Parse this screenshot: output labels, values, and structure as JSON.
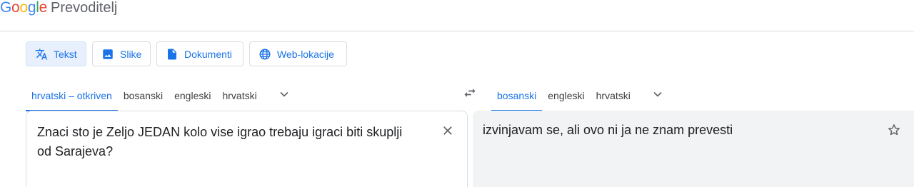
{
  "header": {
    "logo_letters": [
      "G",
      "o",
      "o",
      "g",
      "l",
      "e"
    ],
    "product": "Prevoditelj"
  },
  "modes": [
    {
      "label": "Tekst",
      "icon": "translate-icon",
      "active": true
    },
    {
      "label": "Slike",
      "icon": "image-icon",
      "active": false
    },
    {
      "label": "Dokumenti",
      "icon": "document-icon",
      "active": false
    },
    {
      "label": "Web-lokacije",
      "icon": "globe-icon",
      "active": false
    }
  ],
  "source_langs": [
    "hrvatski – otkriven",
    "bosanski",
    "engleski",
    "hrvatski"
  ],
  "target_langs": [
    "bosanski",
    "engleski",
    "hrvatski"
  ],
  "source": {
    "text": "Znaci sto je Zeljo JEDAN kolo vise igrao trebaju igraci biti skuplji od Sarajeva?"
  },
  "target": {
    "text": "izvinjavam se, ali ovo ni ja ne znam prevesti"
  },
  "colors": {
    "accent": "#1a73e8",
    "active_bg": "#e8f0fe",
    "target_bg": "#f1f3f4",
    "border": "#dadce0"
  }
}
